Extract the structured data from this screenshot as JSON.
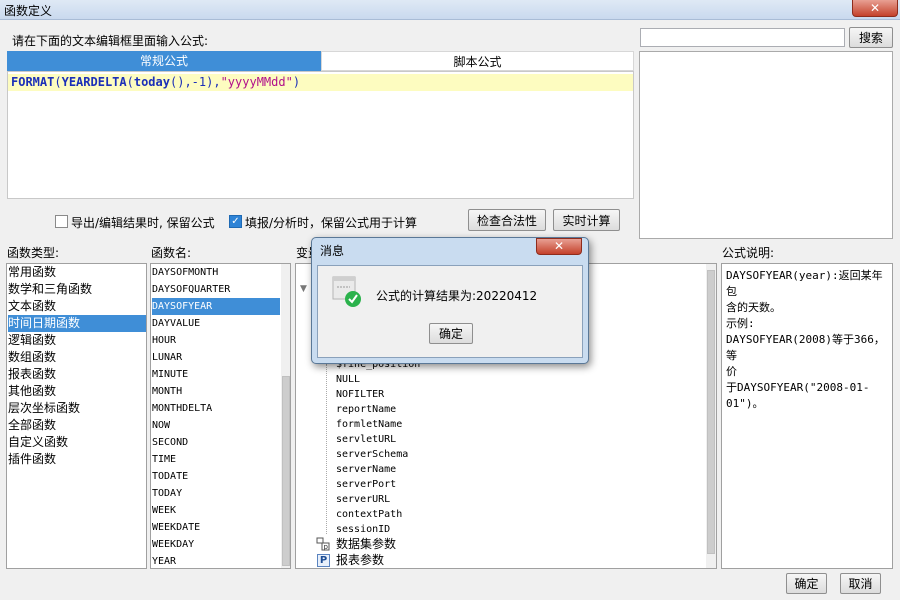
{
  "window": {
    "title": "函数定义",
    "close_label": "✕"
  },
  "editor_prompt": "请在下面的文本编辑框里面输入公式:",
  "search": {
    "value": "",
    "button": "搜索"
  },
  "tabs": [
    {
      "label": "常规公式"
    },
    {
      "label": "脚本公式"
    }
  ],
  "formula": {
    "parts": [
      "FORMAT",
      "(",
      "YEARDELTA",
      "(",
      "today",
      "()",
      ",-1",
      "),",
      "\"yyyyMMdd\"",
      ")"
    ]
  },
  "options": {
    "export_keep": "导出/编辑结果时, 保留公式",
    "fill_keep": "填报/分析时，保留公式用于计算",
    "check_button": "检查合法性",
    "realtime_button": "实时计算"
  },
  "labels": {
    "function_type": "函数类型:",
    "function_name": "函数名:",
    "variables": "变量",
    "formula_desc": "公式说明:"
  },
  "function_types": [
    "常用函数",
    "数学和三角函数",
    "文本函数",
    "时间日期函数",
    "逻辑函数",
    "数组函数",
    "报表函数",
    "其他函数",
    "层次坐标函数",
    "全部函数",
    "自定义函数",
    "插件函数"
  ],
  "function_names": [
    "DAYSOFMONTH",
    "DAYSOFQUARTER",
    "DAYSOFYEAR",
    "DAYVALUE",
    "HOUR",
    "LUNAR",
    "MINUTE",
    "MONTH",
    "MONTHDELTA",
    "NOW",
    "SECOND",
    "TIME",
    "TODATE",
    "TODAY",
    "WEEK",
    "WEEKDATE",
    "WEEKDAY",
    "YEAR"
  ],
  "variables": [
    "$fine_position",
    "NULL",
    "NOFILTER",
    "reportName",
    "formletName",
    "servletURL",
    "serverSchema",
    "serverName",
    "serverPort",
    "serverURL",
    "contextPath",
    "sessionID"
  ],
  "variable_groups": [
    "数据集参数",
    "报表参数"
  ],
  "description": {
    "line1": "DAYSOFYEAR(year):返回某年包",
    "line2": "含的天数。",
    "line3": "示例:",
    "line4": "DAYSOFYEAR(2008)等于366，等",
    "line5": "价",
    "line6": "于DAYSOFYEAR(\"2008-01-",
    "line7": "01\")。"
  },
  "footer": {
    "ok": "确定",
    "cancel": "取消"
  },
  "message": {
    "title": "消息",
    "close_label": "✕",
    "text": "公式的计算结果为:20220412",
    "ok": "确定"
  },
  "colors": {
    "accent": "#3f8ed7",
    "editor_highlight": "#fdfcc0",
    "success": "#2bb24c"
  }
}
